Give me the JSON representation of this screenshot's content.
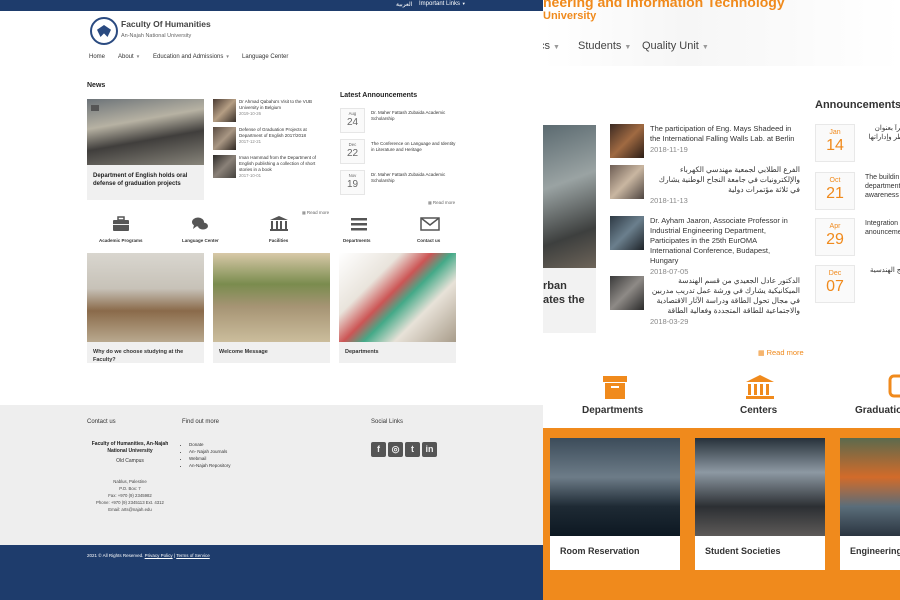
{
  "colors": {
    "front_blue": "#1e3c6c",
    "back_orange": "#f08a1c",
    "gray_footer": "#eeeeee"
  },
  "back_page": {
    "header_title": "neering and Information Technology",
    "header_sub": "University",
    "nav": [
      "cs",
      "Students",
      "Quality Unit"
    ],
    "featured_caption": [
      "rban",
      "ates the"
    ],
    "announcements_title": "Announcements",
    "news": [
      {
        "title": "The participation of Eng. Mays Shadeed in the International Falling Walls Lab. at Berlin",
        "date": "2018-11-19"
      },
      {
        "title": "الفرع الطلابي لجمعية مهندسي الكهرباء والإلكترونيات في جامعة النجاح الوطنية يشارك في ثلاثة مؤتمرات دولية",
        "date": "2018-11-13"
      },
      {
        "title": "Dr. Ayham Jaaron, Associate Professor in Industrial Engineering Department, Participates in the 25th EurOMA International Conference, Budapest, Hungary",
        "date": "2018-07-05"
      },
      {
        "title": "الدكتور عادل الجعيدي من قسم الهندسة الميكانيكية يشارك في ورشة عمل تدريب مدربين في مجال تحول الطاقة ودراسة الآثار الاقتصادية والاجتماعية للطاقة المتجددة وفعالية الطاقة",
        "date": "2018-03-29"
      }
    ],
    "more_label": "Read more",
    "dates": [
      {
        "month": "Jan",
        "day": "14",
        "text": [
          "حرآ بعنوان",
          "اطر وإداراتها"
        ]
      },
      {
        "month": "Oct",
        "day": "21",
        "text": [
          "The buildin",
          "department",
          "awareness"
        ]
      },
      {
        "month": "Apr",
        "day": "29",
        "text": [
          "Integration",
          "anouncemer"
        ]
      },
      {
        "month": "Dec",
        "day": "07",
        "text": [
          "مج الهندسية"
        ]
      }
    ],
    "sections": [
      "Departments",
      "Centers",
      "Graduatio"
    ],
    "cards": [
      "Room Reservation",
      "Student Societies",
      "Engineering"
    ]
  },
  "front_page": {
    "topbar": {
      "arabic": "العربية",
      "links": "Important Links"
    },
    "logo": {
      "title": "Faculty Of Humanities",
      "subtitle": "An-Najah National University"
    },
    "nav": [
      "Home",
      "About",
      "Education and Admissions",
      "Language Center"
    ],
    "news_title": "News",
    "featured": "Department of English holds oral defense of graduation projects",
    "news": [
      {
        "title": "Dr Ahmad Qabaha's Visit to the VUB University in Belgium",
        "date": "2019-10-26"
      },
      {
        "title": "Defense of Graduation Projects at Department of English 2017/2018",
        "date": "2017-12-21"
      },
      {
        "title": "Iman Hammad from the Department of English publishing a collection of short stories in a book",
        "date": "2017-10-01"
      }
    ],
    "news_more": "Read more",
    "ann_title": "Latest Announcements",
    "announcements": [
      {
        "month": "Aug",
        "day": "24",
        "text": "Dr. Maher Fattash Zubaida Academic Scholarship"
      },
      {
        "month": "Dec",
        "day": "22",
        "text": "The Conference on Language and Identity in Literature and Heritage"
      },
      {
        "month": "Nov",
        "day": "19",
        "text": "Dr. Maher Fattash Zubaida Academic Scholarship"
      }
    ],
    "ann_more": "Read more",
    "quick_links": [
      "Academic Programs",
      "Language Center",
      "Facilities",
      "Departments",
      "Contact us"
    ],
    "cards": [
      "Why do we choose studying at the Faculty?",
      "Welcome Message",
      "Departments"
    ],
    "footer": {
      "contact_title": "Contact us",
      "find_title": "Find out more",
      "social_title": "Social Links",
      "org": "Faculty of Humanities, An-Najah National University",
      "campus": "Old Campus",
      "address": [
        "Nablus, Palestine",
        "P.O. Box: 7",
        "Fax: +970 (9) 2345982",
        "Phone: +970 (9) 2345113 Ext. 4312",
        "Email: arts@najah.edu"
      ],
      "links": [
        "Donate",
        "An- Najah Journals",
        "Webmail",
        "An-Najah Repository"
      ],
      "social": [
        "facebook-icon",
        "instagram-icon",
        "twitter-icon",
        "linkedin-icon"
      ]
    },
    "copyright": {
      "text": "2021 © All Rights Reserved.",
      "privacy": "Privacy Policy",
      "sep": "|",
      "terms": "Terms of Service"
    }
  }
}
